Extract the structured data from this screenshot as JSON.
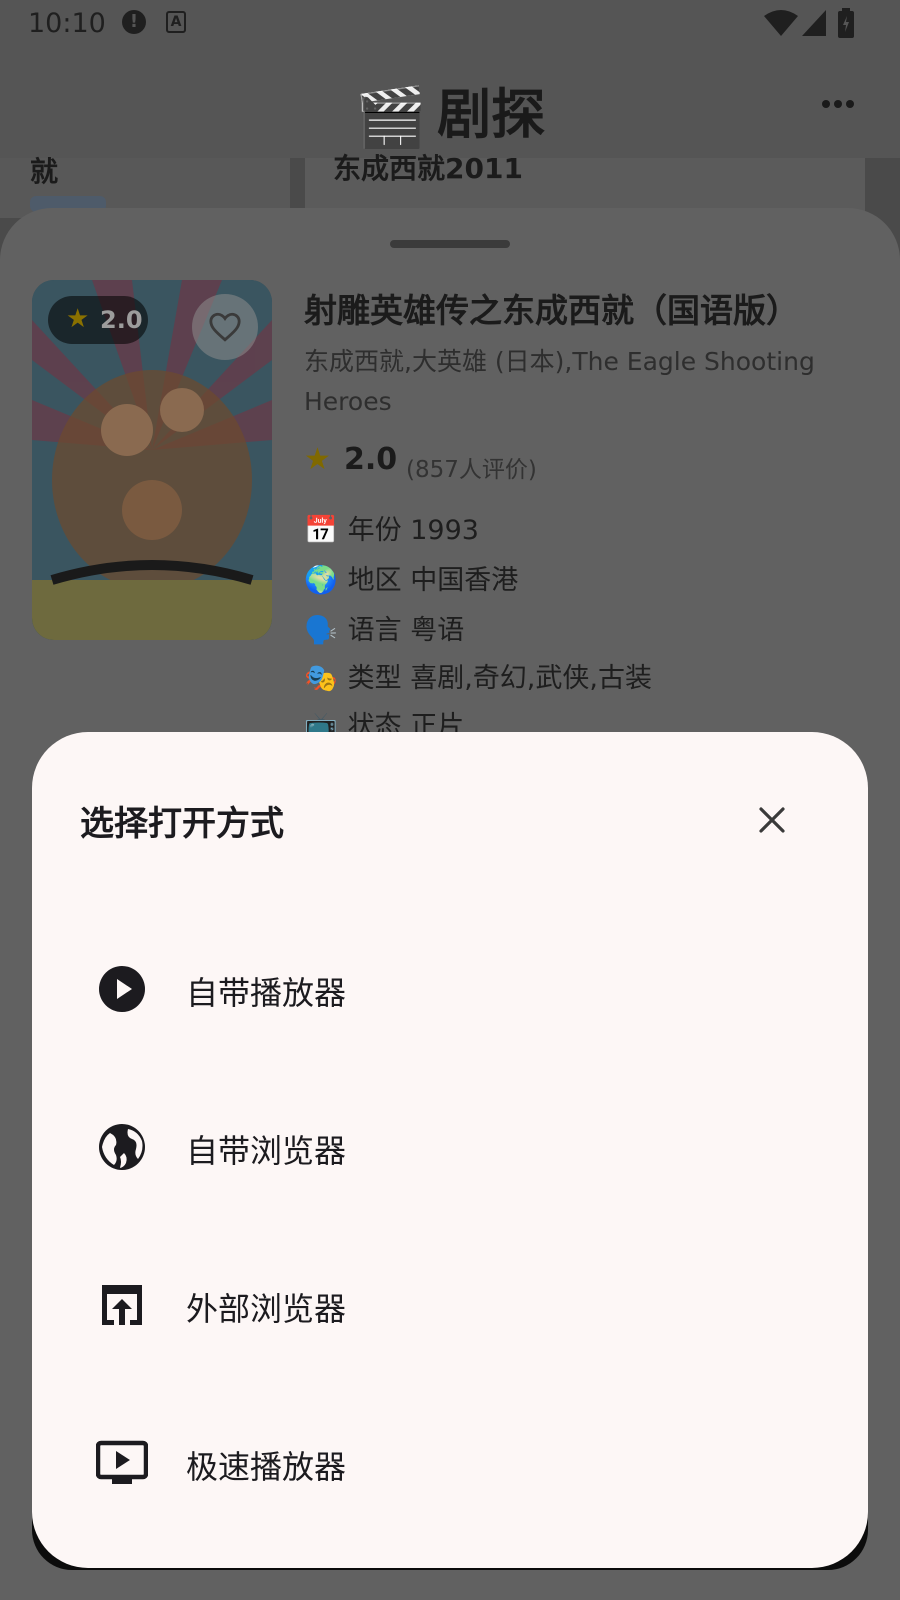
{
  "status_bar": {
    "time": "10:10",
    "alert_glyph": "!",
    "a_glyph": "A",
    "icons": [
      "alert-icon",
      "a-box-icon",
      "wifi-icon",
      "signal-icon",
      "battery-icon"
    ]
  },
  "app_bar": {
    "logo_glyph": "🎬",
    "title": "剧探",
    "menu_icon": "more-horiz-icon"
  },
  "background_list": {
    "left_item_fragment": "就",
    "right_item_fragment": "东成西就2011"
  },
  "movie": {
    "poster_rating_star": "★",
    "poster_rating": "2.0",
    "favorite_icon": "heart-outline-icon",
    "title": "射雕英雄传之东成西就（国语版）",
    "aliases": "东成西就,大英雄 (日本),The Eagle Shooting Heroes",
    "rating_star": "★",
    "rating_value": "2.0",
    "rating_count": "(857人评价)",
    "info": [
      {
        "emoji": "📅",
        "label": "年份",
        "value": "1993"
      },
      {
        "emoji": "🌍",
        "label": "地区",
        "value": "中国香港"
      },
      {
        "emoji": "🗣️",
        "label": "语言",
        "value": "粤语"
      },
      {
        "emoji": "🎭",
        "label": "类型",
        "value": "喜剧,奇幻,武侠,古装"
      },
      {
        "emoji": "📺",
        "label": "状态",
        "value": "正片"
      }
    ]
  },
  "dialog": {
    "title": "选择打开方式",
    "close_icon": "close-icon",
    "options": [
      {
        "label": "自带播放器",
        "icon": "play-circle-icon"
      },
      {
        "label": "自带浏览器",
        "icon": "globe-icon"
      },
      {
        "label": "外部浏览器",
        "icon": "open-in-browser-icon"
      },
      {
        "label": "极速播放器",
        "icon": "tv-play-icon"
      }
    ]
  },
  "colors": {
    "scrim": "#4a4a4a",
    "dialog_bg": "#fdf7f6",
    "text_primary": "#1c1b1f",
    "star": "#806900"
  }
}
